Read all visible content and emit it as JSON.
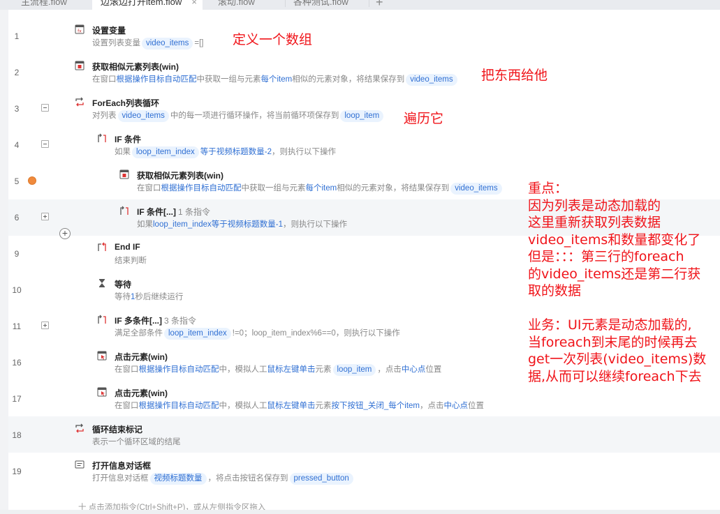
{
  "tabs": [
    {
      "label": "主流程.flow"
    },
    {
      "label": "边滚边打开item.flow",
      "close": "×"
    },
    {
      "label": "滚动.flow"
    },
    {
      "label": "各种测试.flow"
    }
  ],
  "add_tab": "+",
  "rows": [
    {
      "num": "1",
      "title": "设置变量",
      "icon": "variable-icon",
      "desc": {
        "t1": "设置列表变量",
        "c1": "video_items",
        "t2": "=[]"
      }
    },
    {
      "num": "2",
      "title": "获取相似元素列表(win)",
      "icon": "element-list-icon",
      "desc": {
        "t1": "在窗口",
        "l1": "根据操作目标自动匹配",
        "t2": "中获取一组与元素",
        "l2": "每个item",
        "t3": "相似的元素对象，将结果保存到",
        "c1": "video_items"
      }
    },
    {
      "num": "3",
      "title": "ForEach列表循环",
      "icon": "loop-icon",
      "desc": {
        "t1": "对列表",
        "c1": "video_items",
        "t2": "中的每一项进行循环操作，将当前循环项保存到",
        "c2": "loop_item"
      }
    },
    {
      "num": "4",
      "title": "IF 条件",
      "icon": "if-icon",
      "desc": {
        "t1": "如果",
        "c1": "loop_item_index",
        "l1": "等于",
        "l2": "视频标题数量-2",
        "t2": "，则执行以下操作"
      }
    },
    {
      "num": "5",
      "title": "获取相似元素列表(win)",
      "icon": "element-list-icon",
      "desc": {
        "t1": "在窗口",
        "l1": "根据操作目标自动匹配",
        "t2": "中获取一组与元素",
        "l2": "每个item",
        "t3": "相似的元素对象，将结果保存到",
        "c1": "video_items"
      }
    },
    {
      "num": "6",
      "title": "IF 条件[...]",
      "count": "1 条指令",
      "icon": "if-icon",
      "desc": {
        "t1": "如果",
        "l1": "loop_item_index",
        "l2": "等于",
        "l3": "视频标题数量-1",
        "t2": "，则执行以下操作"
      }
    },
    {
      "num": "9",
      "title": "End IF",
      "icon": "end-if-icon",
      "desc": {
        "t1": "结束判断"
      }
    },
    {
      "num": "10",
      "title": "等待",
      "icon": "hourglass-icon",
      "desc": {
        "t1": "等待",
        "l1": "1",
        "t2": "秒后继续运行"
      }
    },
    {
      "num": "11",
      "title": "IF 多条件[...]",
      "count": "3 条指令",
      "icon": "if-icon",
      "desc": {
        "t1": "满足全部条件",
        "c1": "loop_item_index",
        "t2": "!=0；loop_item_index%6==0，则执行以下操作"
      }
    },
    {
      "num": "16",
      "title": "点击元素(win)",
      "icon": "click-icon",
      "desc": {
        "t1": "在窗口",
        "l1": "根据操作目标自动匹配",
        "t2": "中，模拟人工",
        "l2": "鼠标左键单击",
        "t3": "元素",
        "c1": "loop_item",
        "t4": "，点击",
        "l3": "中心点",
        "t5": "位置"
      }
    },
    {
      "num": "17",
      "title": "点击元素(win)",
      "icon": "click-icon",
      "desc": {
        "t1": "在窗口",
        "l1": "根据操作目标自动匹配",
        "t2": "中，模拟人工",
        "l2": "鼠标左键单击",
        "t3": "元素",
        "l3": "按下按钮_关闭_每个item",
        "t4": "，点击",
        "l4": "中心点",
        "t5": "位置"
      }
    },
    {
      "num": "18",
      "title": "循环结束标记",
      "icon": "loop-end-icon",
      "desc": {
        "t1": "表示一个循环区域的结尾"
      }
    },
    {
      "num": "19",
      "title": "打开信息对话框",
      "icon": "dialog-icon",
      "desc": {
        "t1": "打开信息对话框",
        "c1": "视频标题数量",
        "t2": "，将点击按钮名保存到",
        "c2": "pressed_button"
      }
    }
  ],
  "fold_controls": {
    "minus": "−",
    "plus": "+"
  },
  "footer": "十 点击添加指令(Ctrl+Shift+P)，或从左侧指令区拖入",
  "annotations": {
    "a1": "定义一个数组",
    "a2": "把东西给他",
    "a3": "遍历它",
    "big": [
      "重点：",
      "因为列表是动态加载的",
      "这里重新获取列表数据",
      "video_items和数量都变化了",
      "但是：：：第三行的foreach",
      "的video_items还是第二行获",
      "取的数据",
      "",
      "业务：UI元素是动态加载的,",
      "当foreach到末尾的时候再去",
      "get一次列表(video_items)数",
      "据,从而可以继续foreach下去"
    ]
  },
  "colors": {
    "annotation": "#f0141a",
    "link": "#2f6fd3",
    "chip_bg": "#eaf3fe",
    "breakpoint": "#f08a3c"
  }
}
